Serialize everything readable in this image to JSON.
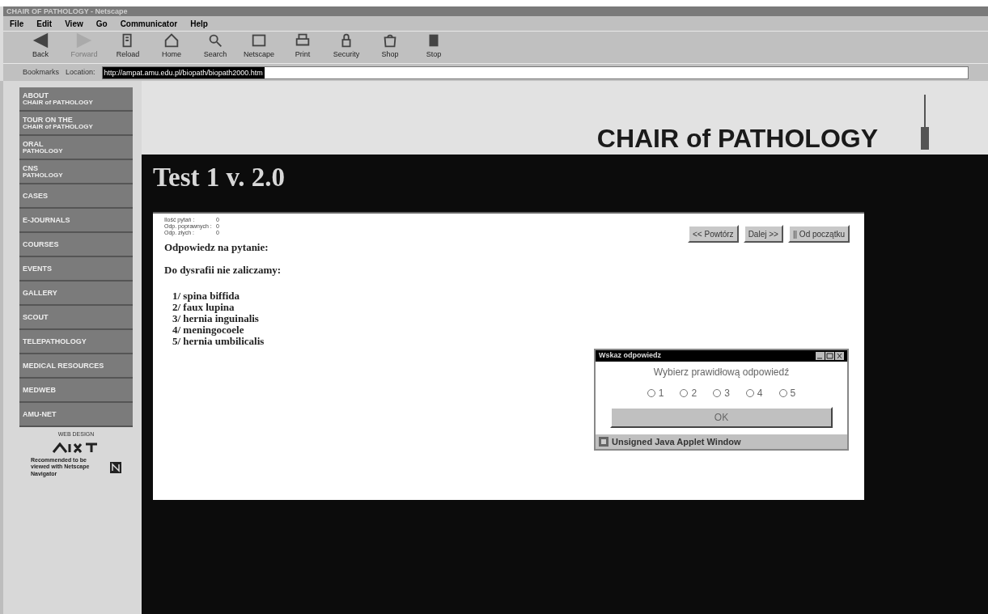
{
  "window": {
    "title": "CHAIR OF PATHOLOGY - Netscape"
  },
  "menu": [
    "File",
    "Edit",
    "View",
    "Go",
    "Communicator",
    "Help"
  ],
  "toolbar": [
    {
      "label": "Back",
      "disabled": false
    },
    {
      "label": "Forward",
      "disabled": true
    },
    {
      "label": "Reload",
      "disabled": false
    },
    {
      "label": "Home",
      "disabled": false
    },
    {
      "label": "Search",
      "disabled": false
    },
    {
      "label": "Netscape",
      "disabled": false
    },
    {
      "label": "Print",
      "disabled": false
    },
    {
      "label": "Security",
      "disabled": false
    },
    {
      "label": "Shop",
      "disabled": false
    },
    {
      "label": "Stop",
      "disabled": false
    }
  ],
  "location_bar": {
    "bookmarks": "Bookmarks",
    "location_label": "Location:",
    "url": "http://ampat.amu.edu.pl/biopath/biopath2000.htm"
  },
  "sidebar": {
    "items": [
      {
        "label": "ABOUT",
        "sub": "CHAIR of PATHOLOGY"
      },
      {
        "label": "TOUR ON THE",
        "sub": "CHAIR of PATHOLOGY"
      },
      {
        "label": "ORAL",
        "sub": "PATHOLOGY"
      },
      {
        "label": "CNS",
        "sub": "PATHOLOGY"
      },
      {
        "label": "CASES"
      },
      {
        "label": "E-JOURNALS"
      },
      {
        "label": "COURSES"
      },
      {
        "label": "EVENTS"
      },
      {
        "label": "GALLERY"
      },
      {
        "label": "SCOUT"
      },
      {
        "label": "TELEPATHOLOGY"
      },
      {
        "label": "MEDICAL RESOURCES"
      },
      {
        "label": "MEDWEB"
      },
      {
        "label": "AMU-NET"
      }
    ],
    "web_design": "WEB DESIGN",
    "recommended": "Recommended to be viewed with Netscape Navigator"
  },
  "header": {
    "title": "CHAIR of PATHOLOGY"
  },
  "test": {
    "title": "Test 1 v. 2.0",
    "stats": [
      {
        "label": "Ilość pytań :",
        "value": "0"
      },
      {
        "label": "Odp. poprawnych :",
        "value": "0"
      },
      {
        "label": "Odp. złych :",
        "value": "0"
      }
    ],
    "buttons": [
      "<< Powtórz",
      "Dalej >>",
      "|| Od początku"
    ],
    "heading": "Odpowiedz na pytanie:",
    "question": "Do dysrafii nie zaliczamy:",
    "answers": [
      "1/ spina biffida",
      "2/ faux lupina",
      "3/ hernia inguinalis",
      "4/ meningocoele",
      "5/ hernia umbilicalis"
    ]
  },
  "dialog": {
    "title": "Wskaz odpowiedz",
    "prompt": "Wybierz prawidłową odpowiedź",
    "options": [
      {
        "label": "1",
        "selected": false
      },
      {
        "label": "2",
        "selected": false
      },
      {
        "label": "3",
        "selected": false
      },
      {
        "label": "4",
        "selected": false
      },
      {
        "label": "5",
        "selected": false
      }
    ],
    "ok": "OK",
    "status": "Unsigned Java Applet Window"
  }
}
